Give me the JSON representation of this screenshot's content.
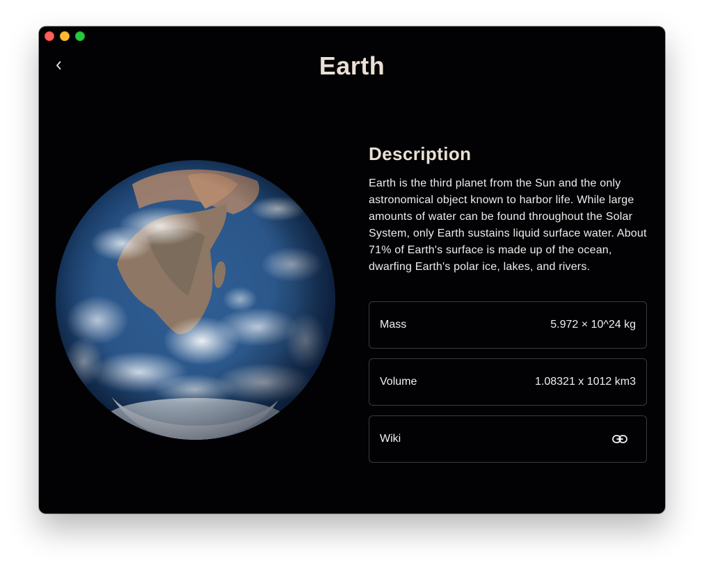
{
  "window": {
    "title": "Earth"
  },
  "header": {
    "back_icon": "chevron-left-icon",
    "title": "Earth"
  },
  "image": {
    "subject": "planet-earth-photo"
  },
  "description": {
    "heading": "Description",
    "body": "Earth is the third planet from the Sun and the only astronomical object known to harbor life. While large amounts of water can be found throughout the Solar System, only Earth sustains liquid surface water. About 71% of Earth's surface is made up of the ocean, dwarfing Earth's polar ice, lakes, and rivers."
  },
  "facts": {
    "mass": {
      "label": "Mass",
      "value": "5.972 × 10^24 kg"
    },
    "volume": {
      "label": "Volume",
      "value": "1.08321 x 1012 km3"
    },
    "wiki": {
      "label": "Wiki",
      "icon": "link-icon"
    }
  },
  "colors": {
    "background": "#020204",
    "title": "#e9e0d4",
    "card_border": "#3b3b3d",
    "text": "#eeeeee"
  }
}
